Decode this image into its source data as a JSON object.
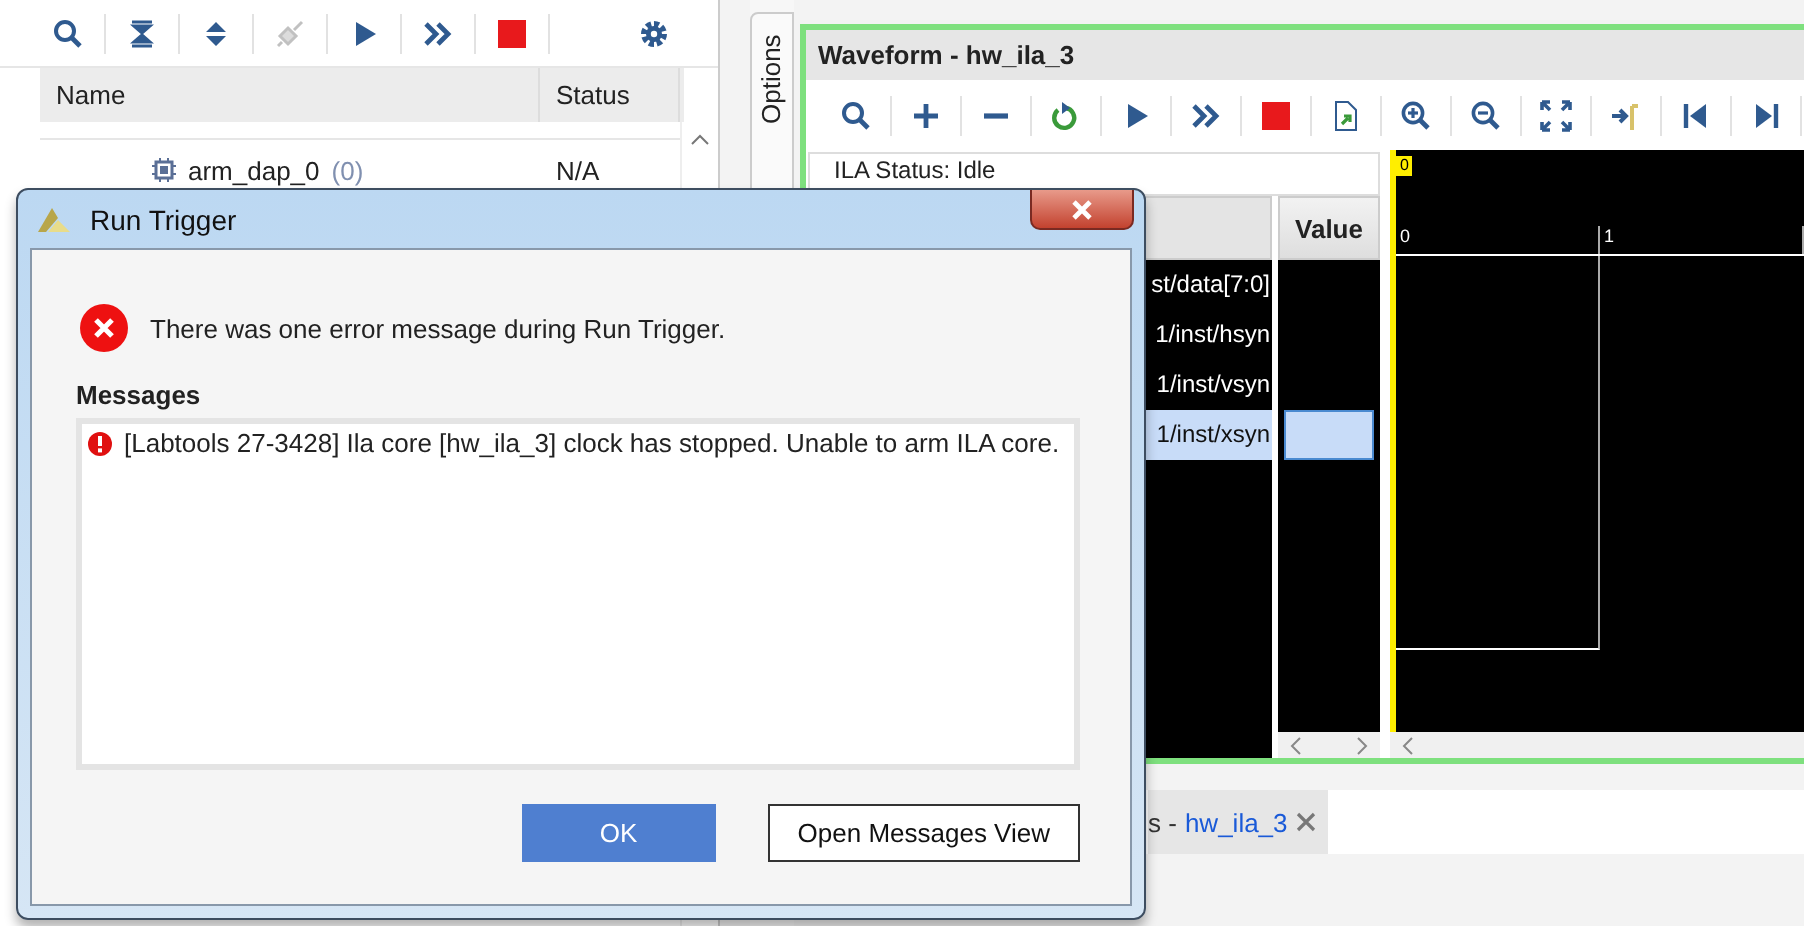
{
  "hardware_panel": {
    "toolbar": [
      {
        "kind": "search",
        "disabled": false
      },
      {
        "kind": "collapse",
        "disabled": false
      },
      {
        "kind": "expand",
        "disabled": false
      },
      {
        "kind": "connect",
        "disabled": true
      },
      {
        "kind": "run",
        "disabled": false
      },
      {
        "kind": "run-all",
        "disabled": false
      },
      {
        "kind": "stop",
        "disabled": false
      },
      {
        "kind": "settings",
        "disabled": false
      }
    ],
    "columns": [
      "Name",
      "Status"
    ],
    "rows": [
      {
        "name": "arm_dap_0",
        "count": "(0)",
        "status": "N/A"
      }
    ]
  },
  "side_tab": "Options",
  "waveform": {
    "title": "Waveform - hw_ila_3",
    "toolbar": [
      {
        "kind": "search"
      },
      {
        "kind": "add"
      },
      {
        "kind": "remove"
      },
      {
        "kind": "refresh"
      },
      {
        "kind": "run"
      },
      {
        "kind": "run-all"
      },
      {
        "kind": "stop"
      },
      {
        "kind": "export"
      },
      {
        "kind": "zoom-in"
      },
      {
        "kind": "zoom-out"
      },
      {
        "kind": "fit"
      },
      {
        "kind": "goto-cursor"
      },
      {
        "kind": "first"
      },
      {
        "kind": "last"
      }
    ],
    "status": "ILA Status: Idle",
    "value_column": "Value",
    "signals": [
      {
        "name": "st/data[7:0]",
        "selected": false
      },
      {
        "name": "1/inst/hsyn",
        "selected": false
      },
      {
        "name": "1/inst/vsyn",
        "selected": false
      },
      {
        "name": "1/inst/xsyn",
        "selected": true
      }
    ],
    "marker": "0",
    "time_labels": [
      "0",
      "1"
    ]
  },
  "bottom_tab": {
    "prefix": "s -",
    "title": "hw_ila_3"
  },
  "dialog": {
    "title": "Run Trigger",
    "summary": "There was one error message during Run Trigger.",
    "messages_label": "Messages",
    "messages": [
      {
        "text": "[Labtools 27-3428] Ila core [hw_ila_3] clock has stopped. Unable to arm ILA core."
      }
    ],
    "buttons": [
      {
        "label": "OK",
        "primary": true
      },
      {
        "label": "Open Messages View",
        "primary": false
      }
    ]
  }
}
